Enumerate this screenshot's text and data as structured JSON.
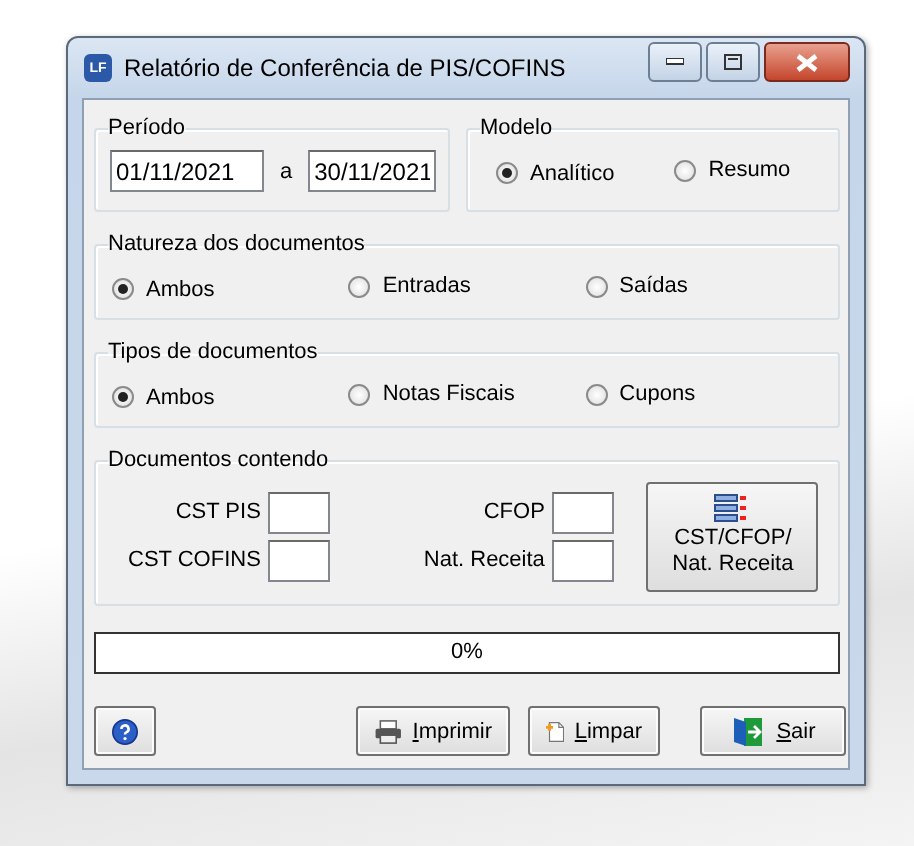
{
  "window": {
    "title": "Relatório de Conferência de PIS/COFINS",
    "logo": "LF"
  },
  "periodo": {
    "label": "Período",
    "from": "01/11/2021",
    "separator": "a",
    "to": "30/11/2021"
  },
  "modelo": {
    "label": "Modelo",
    "options": [
      {
        "label": "Analítico",
        "selected": true
      },
      {
        "label": "Resumo",
        "selected": false
      }
    ]
  },
  "natureza": {
    "label": "Natureza dos documentos",
    "options": [
      {
        "label": "Ambos",
        "selected": true
      },
      {
        "label": "Entradas",
        "selected": false
      },
      {
        "label": "Saídas",
        "selected": false
      }
    ]
  },
  "tipos": {
    "label": "Tipos de documentos",
    "options": [
      {
        "label": "Ambos",
        "selected": true
      },
      {
        "label": "Notas Fiscais",
        "selected": false
      },
      {
        "label": "Cupons",
        "selected": false
      }
    ]
  },
  "documentos": {
    "label": "Documentos contendo",
    "fields": [
      {
        "label": "CST PIS"
      },
      {
        "label": "CST COFINS"
      },
      {
        "label": "CFOP"
      },
      {
        "label": "Nat. Receita"
      }
    ],
    "button_lines": [
      "CST/CFOP/",
      "Nat. Receita"
    ]
  },
  "progress": {
    "level": 0,
    "text": "0%"
  },
  "buttons": [
    {
      "kind": "help"
    },
    {
      "kind": "print",
      "label": "Imprimir"
    },
    {
      "kind": "clear",
      "label": "Limpar"
    },
    {
      "kind": "exit",
      "label": "Sair"
    }
  ]
}
